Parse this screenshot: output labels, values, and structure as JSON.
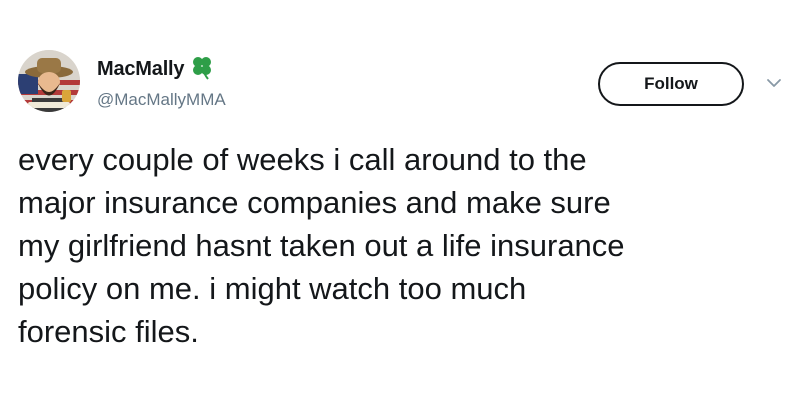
{
  "tweet": {
    "author": {
      "display_name": "MacMally",
      "handle": "@MacMallyMMA",
      "name_badge_icon": "four-leaf-clover-icon"
    },
    "follow_label": "Follow",
    "menu_icon": "chevron-down-icon",
    "text": "every couple of weeks i call around to the\nmajor insurance companies and make sure\nmy girlfriend hasnt taken out a life insurance\npolicy on me. i might watch too much\nforensic files."
  },
  "colors": {
    "text_primary": "#14171a",
    "text_secondary": "#657786",
    "clover": "#2e9e48",
    "background": "#ffffff"
  }
}
